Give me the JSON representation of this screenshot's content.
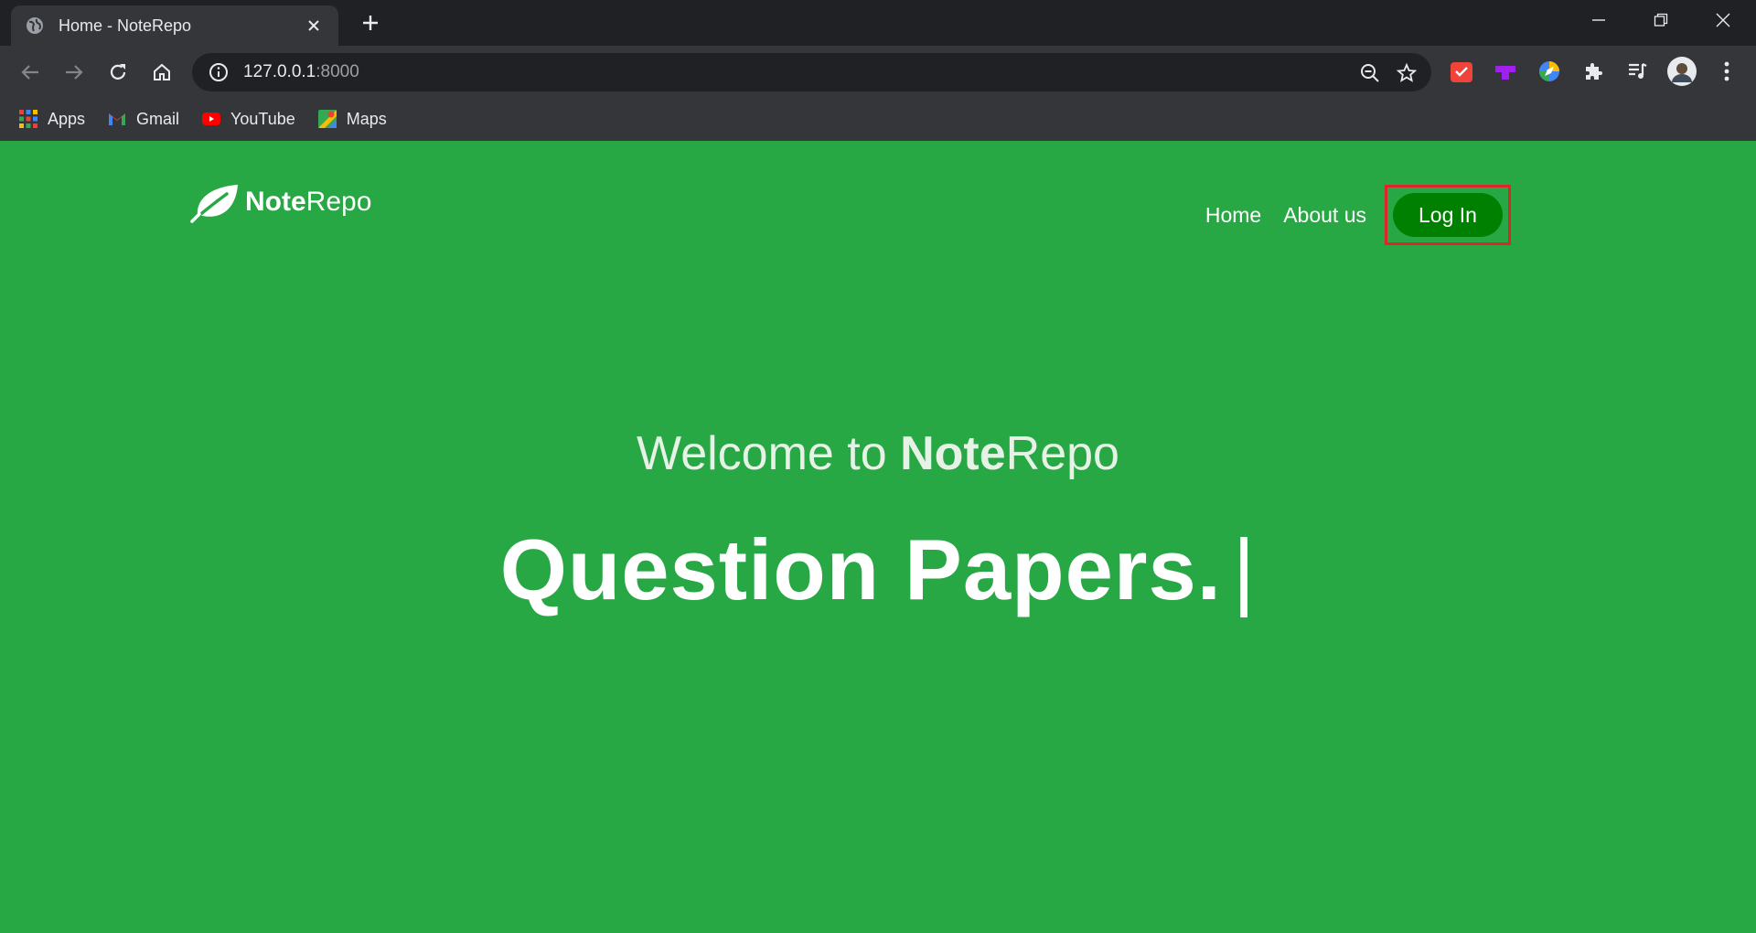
{
  "browser": {
    "tab_title": "Home - NoteRepo",
    "url_host": "127.0.0.1",
    "url_port": ":8000",
    "bookmarks": [
      {
        "label": "Apps",
        "icon": "apps-grid-icon"
      },
      {
        "label": "Gmail",
        "icon": "gmail-icon"
      },
      {
        "label": "YouTube",
        "icon": "youtube-icon"
      },
      {
        "label": "Maps",
        "icon": "maps-icon"
      }
    ]
  },
  "site": {
    "logo_bold": "Note",
    "logo_rest": "Repo",
    "nav": {
      "home": "Home",
      "about": "About us",
      "login": "Log In"
    },
    "hero": {
      "welcome_prefix": "Welcome to ",
      "welcome_bold": "Note",
      "welcome_rest": "Repo",
      "typed_text": "Question Papers.",
      "cursor": "|"
    }
  },
  "colors": {
    "page_bg": "#28a745",
    "login_bg": "#008000",
    "highlight": "#e0242e",
    "chrome_dark": "#202124",
    "chrome_mid": "#35363a"
  }
}
